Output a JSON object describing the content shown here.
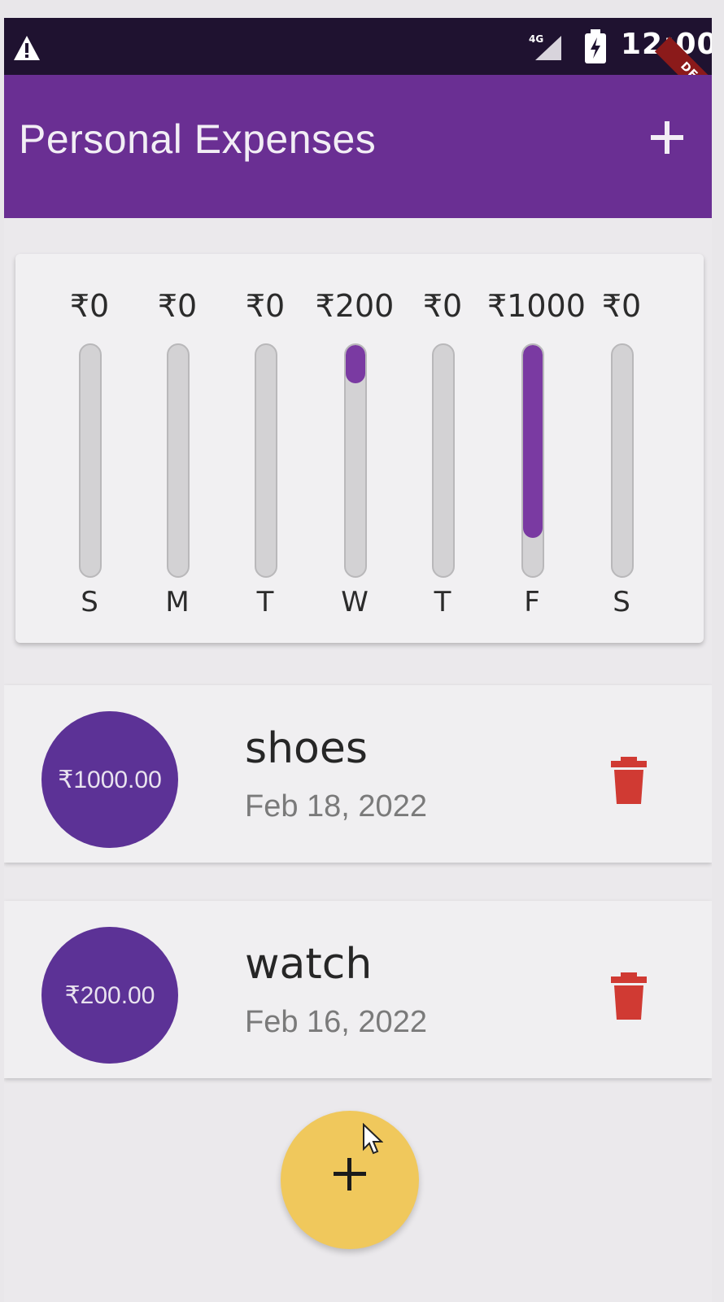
{
  "status_bar": {
    "network": "4G",
    "time": "12:00",
    "debug_banner": "DEBUG"
  },
  "app_bar": {
    "title": "Personal Expenses",
    "add_icon": "plus-icon"
  },
  "chart_data": {
    "type": "bar",
    "categories": [
      "S",
      "M",
      "T",
      "W",
      "T",
      "F",
      "S"
    ],
    "value_labels": [
      "₹0",
      "₹0",
      "₹0",
      "₹200",
      "₹0",
      "₹1000",
      "₹0"
    ],
    "values": [
      0,
      0,
      0,
      200,
      0,
      1000,
      0
    ],
    "fill_fractions": [
      0,
      0,
      0,
      0.1667,
      0,
      0.8333,
      0
    ],
    "colors": {
      "fill": "#7a3aa2",
      "track": "#d3d2d4"
    }
  },
  "transactions": [
    {
      "amount": "₹1000.00",
      "title": "shoes",
      "date": "Feb 18, 2022"
    },
    {
      "amount": "₹200.00",
      "title": "watch",
      "date": "Feb 16, 2022"
    }
  ],
  "fab": {
    "icon": "plus-icon"
  },
  "colors": {
    "primary": "#6a2f93",
    "accent": "#f0c85c",
    "delete": "#d03a33"
  }
}
